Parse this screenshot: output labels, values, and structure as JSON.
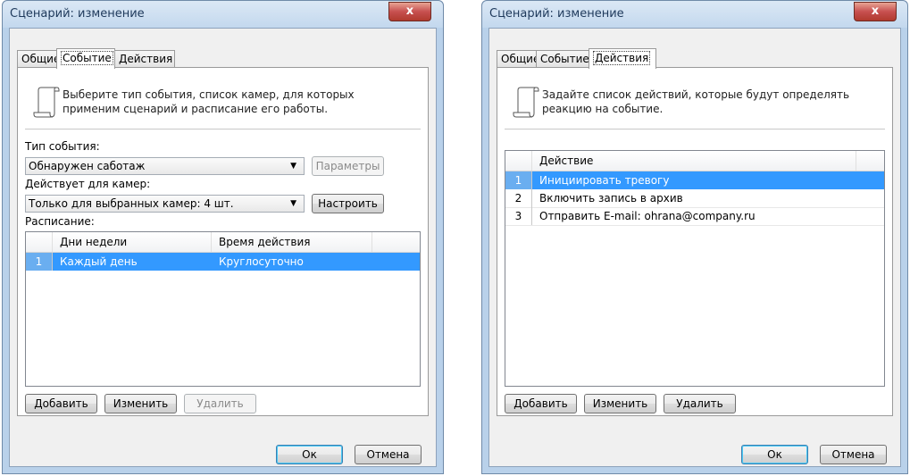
{
  "left_dialog": {
    "title": "Сценарий: изменение",
    "close_label": "x",
    "tabs": [
      {
        "label": "Общие"
      },
      {
        "label": "Событие"
      },
      {
        "label": "Действия"
      }
    ],
    "intro": [
      "Выберите тип события, список камер, для которых",
      "применим сценарий и расписание его работы."
    ],
    "event_type_label": "Тип события:",
    "event_type_value": "Обнаружен саботаж",
    "params_button": "Параметры",
    "cameras_label": "Действует для камер:",
    "cameras_value": "Только для выбранных камер: 4 шт.",
    "configure_button": "Настроить",
    "schedule_label": "Расписание:",
    "schedule_columns": [
      "Дни недели",
      "Время действия"
    ],
    "schedule_rows": [
      {
        "num": "1",
        "days": "Каждый день",
        "time": "Круглосуточно"
      }
    ],
    "add_button": "Добавить",
    "edit_button": "Изменить",
    "delete_button": "Удалить",
    "ok_button": "Ок",
    "cancel_button": "Отмена"
  },
  "right_dialog": {
    "title": "Сценарий: изменение",
    "close_label": "x",
    "tabs": [
      {
        "label": "Общие"
      },
      {
        "label": "Событие"
      },
      {
        "label": "Действия"
      }
    ],
    "intro": [
      "Задайте список действий, которые будут определять",
      "реакцию на событие."
    ],
    "actions_column": "Действие",
    "actions_rows": [
      {
        "num": "1",
        "action": "Инициировать тревогу"
      },
      {
        "num": "2",
        "action": "Включить запись в архив"
      },
      {
        "num": "3",
        "action": "Отправить E-mail: ohrana@company.ru"
      }
    ],
    "add_button": "Добавить",
    "edit_button": "Изменить",
    "delete_button": "Удалить",
    "ok_button": "Ок",
    "cancel_button": "Отмена"
  },
  "colors": {
    "selection": "#3399ff",
    "frame": "#b9d1ea",
    "close": "#c75050"
  }
}
